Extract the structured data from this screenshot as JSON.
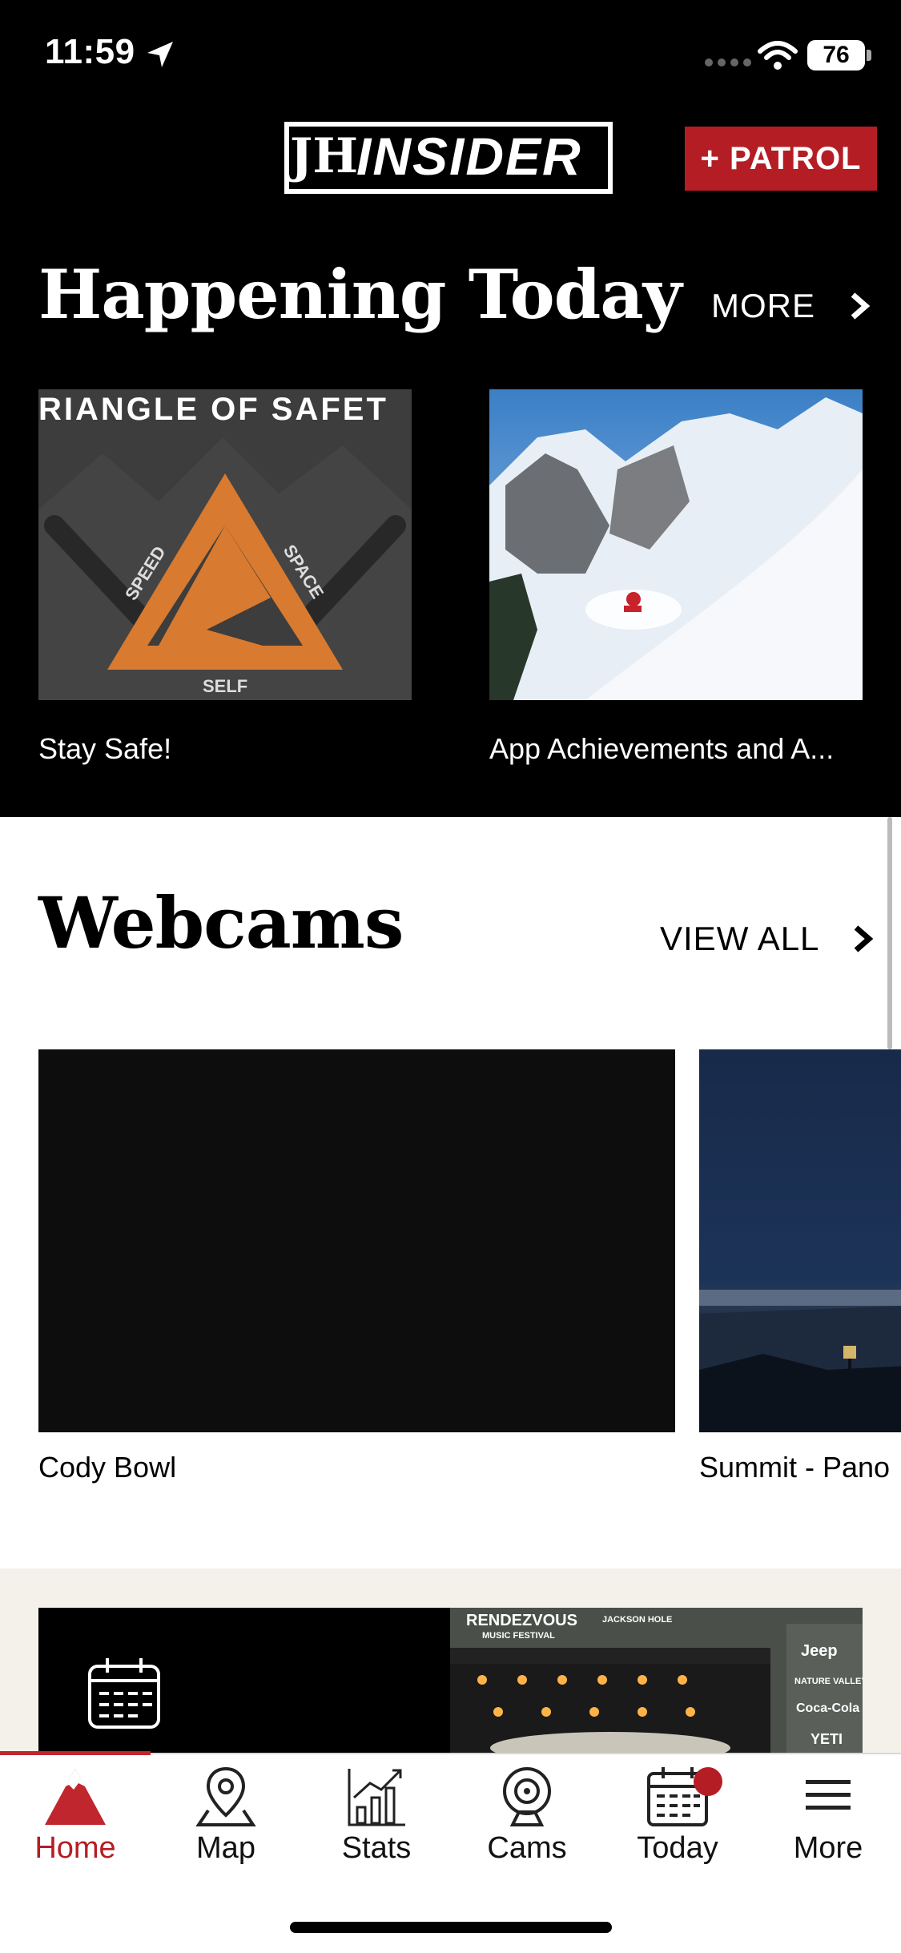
{
  "status": {
    "time": "11:59",
    "battery": "76"
  },
  "header": {
    "logo_mark": "JH",
    "logo_text": "INSIDER",
    "patrol_label": "+ PATROL"
  },
  "happening": {
    "title": "Happening Today",
    "more_label": "MORE",
    "cards": [
      {
        "caption": "Stay Safe!",
        "banner": "RIANGLE OF SAFET",
        "labels": [
          "SPEED",
          "SPACE",
          "SELF"
        ]
      },
      {
        "caption": "App Achievements and A..."
      }
    ]
  },
  "webcams": {
    "title": "Webcams",
    "view_all_label": "VIEW ALL",
    "cams": [
      {
        "caption": "Cody Bowl"
      },
      {
        "caption": "Summit - Pano"
      }
    ]
  },
  "promo": {
    "image_text": [
      "RENDEZVOUS",
      "MUSIC FESTIVAL",
      "JACKSON HOLE",
      "Jeep",
      "NATURE VALLEY",
      "Coca-Cola",
      "YETI"
    ]
  },
  "tabs": [
    {
      "label": "Home",
      "icon": "mountain-icon",
      "active": true
    },
    {
      "label": "Map",
      "icon": "map-pin-icon"
    },
    {
      "label": "Stats",
      "icon": "stats-chart-icon"
    },
    {
      "label": "Cams",
      "icon": "webcam-icon"
    },
    {
      "label": "Today",
      "icon": "calendar-icon",
      "badge": true
    },
    {
      "label": "More",
      "icon": "hamburger-menu-icon"
    }
  ],
  "colors": {
    "accent": "#b51d24",
    "header_bg": "#000000",
    "promo_bg": "#f4f1ea"
  }
}
